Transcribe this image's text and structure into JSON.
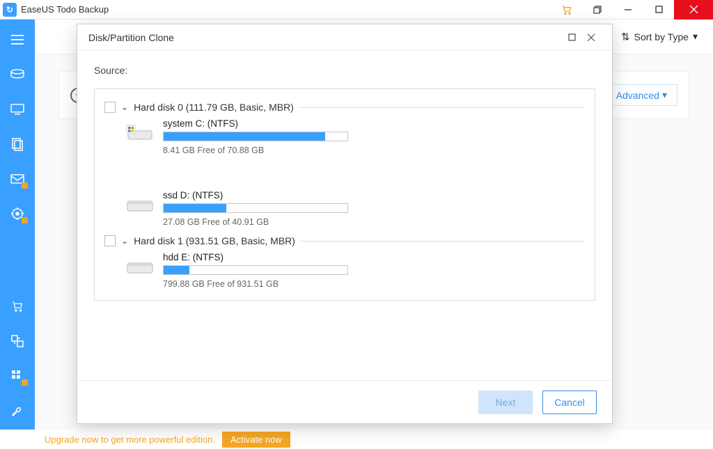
{
  "titlebar": {
    "app_name": "EaseUS Todo Backup"
  },
  "toolbar": {
    "sort_label": "Sort by Type",
    "advanced_label": "Advanced"
  },
  "promo": {
    "message": "Upgrade now to get more powerful edition.",
    "action": "Activate now"
  },
  "modal": {
    "title": "Disk/Partition Clone",
    "source_label": "Source:",
    "next_label": "Next",
    "cancel_label": "Cancel",
    "disks": [
      {
        "label": "Hard disk 0 (111.79 GB, Basic, MBR)",
        "partitions": [
          {
            "name": "system C: (NTFS)",
            "free_text": "8.41 GB Free of 70.88 GB",
            "used_pct": 88,
            "is_system": true
          },
          {
            "name": "ssd D: (NTFS)",
            "free_text": "27.08 GB Free of 40.91 GB",
            "used_pct": 34,
            "is_system": false
          }
        ]
      },
      {
        "label": "Hard disk 1 (931.51 GB, Basic, MBR)",
        "partitions": [
          {
            "name": "hdd E: (NTFS)",
            "free_text": "799.88 GB Free of 931.51 GB",
            "used_pct": 14,
            "is_system": false
          }
        ]
      }
    ]
  }
}
